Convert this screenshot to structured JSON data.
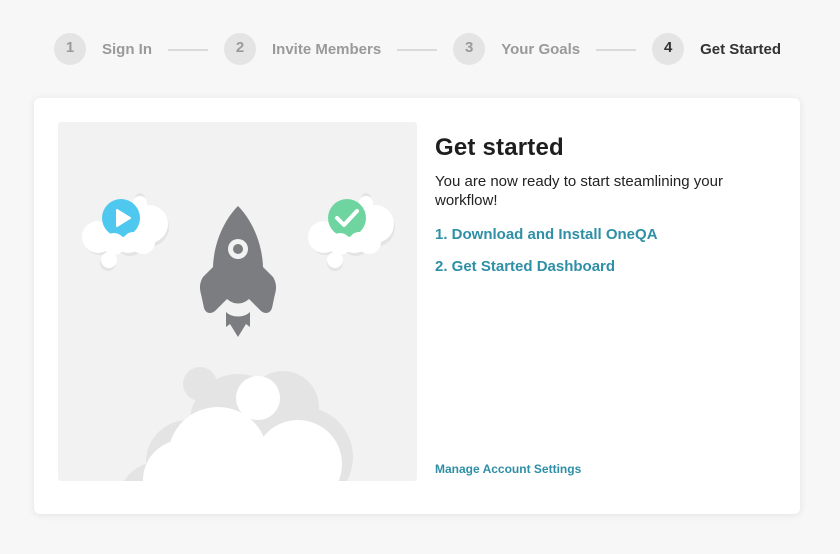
{
  "stepper": {
    "steps": [
      {
        "number": "1",
        "label": "Sign In",
        "active": false
      },
      {
        "number": "2",
        "label": "Invite Members",
        "active": false
      },
      {
        "number": "3",
        "label": "Your Goals",
        "active": false
      },
      {
        "number": "4",
        "label": "Get Started",
        "active": true
      }
    ]
  },
  "main": {
    "title": "Get started",
    "description": "You are now ready to start steamlining your workflow!",
    "links": [
      {
        "label": "1. Download and Install OneQA"
      },
      {
        "label": "2. Get Started Dashboard"
      }
    ],
    "manage_link": "Manage Account Settings"
  },
  "illustration": {
    "icons": [
      "play-icon",
      "rocket-icon",
      "check-icon",
      "cloud-icon"
    ],
    "colors": {
      "play": "#4fc8ef",
      "check": "#6fd5a0",
      "rocket": "#7c7d80",
      "link": "#2f8fa6"
    }
  }
}
